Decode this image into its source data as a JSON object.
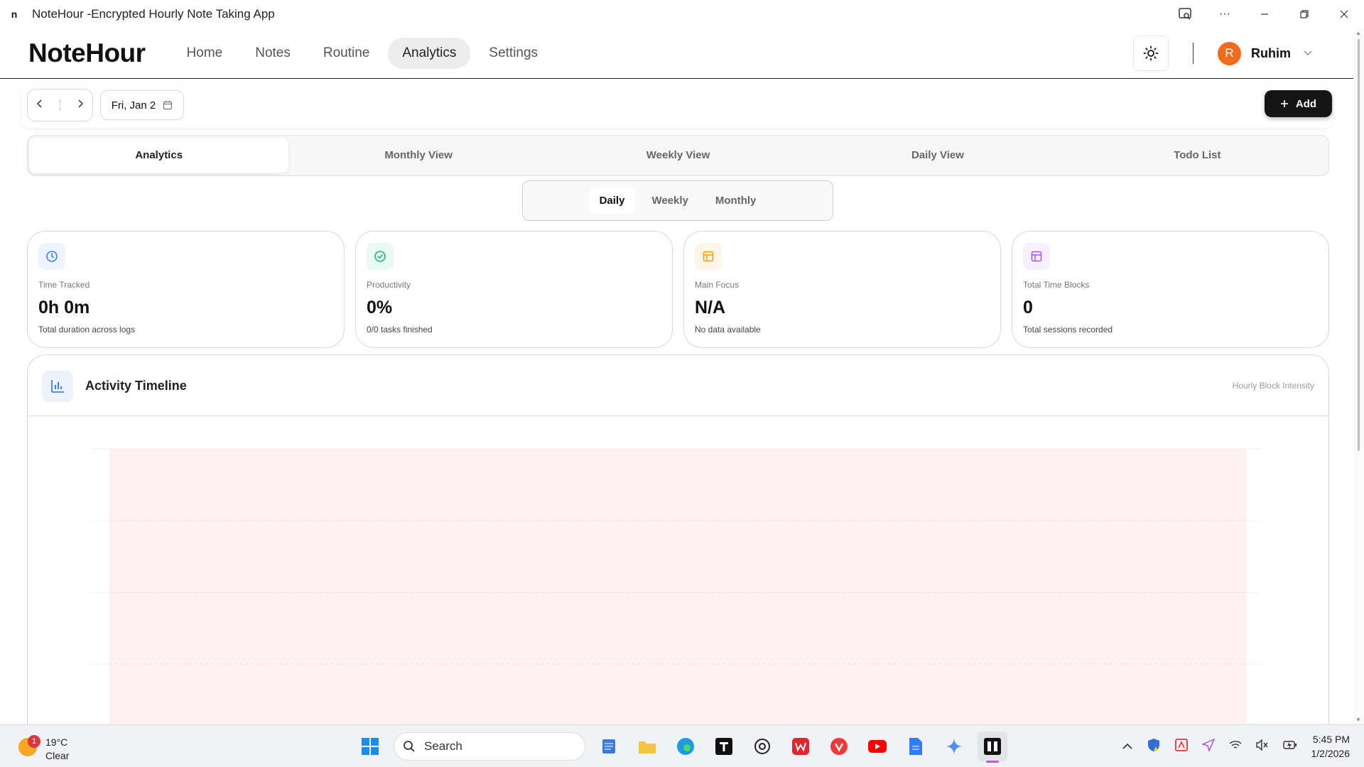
{
  "window": {
    "title": "NoteHour -Encrypted Hourly Note Taking App",
    "app_glyph": "n"
  },
  "header": {
    "brand": "NoteHour",
    "nav": [
      {
        "label": "Home"
      },
      {
        "label": "Notes"
      },
      {
        "label": "Routine"
      },
      {
        "label": "Analytics",
        "active": true
      },
      {
        "label": "Settings"
      }
    ],
    "user": {
      "initial": "R",
      "name": "Ruhim"
    }
  },
  "toolbar": {
    "date": "Fri, Jan 2",
    "add_label": "Add"
  },
  "main_tabs": [
    {
      "label": "Analytics",
      "active": true
    },
    {
      "label": "Monthly View"
    },
    {
      "label": "Weekly View"
    },
    {
      "label": "Daily View"
    },
    {
      "label": "Todo List"
    }
  ],
  "period": [
    {
      "label": "Daily",
      "active": true
    },
    {
      "label": "Weekly"
    },
    {
      "label": "Monthly"
    }
  ],
  "cards": [
    {
      "label": "Time Tracked",
      "value": "0h 0m",
      "sub": "Total duration across logs",
      "icon": "clock-icon",
      "color": "#3b82f6",
      "bg": "#eef4ff"
    },
    {
      "label": "Productivity",
      "value": "0%",
      "sub": "0/0 tasks finished",
      "icon": "check-circle-icon",
      "color": "#10b981",
      "bg": "#e9f8f2"
    },
    {
      "label": "Main Focus",
      "value": "N/A",
      "sub": "No data available",
      "icon": "layout-icon",
      "color": "#f59e0b",
      "bg": "#fff5e6"
    },
    {
      "label": "Total Time Blocks",
      "value": "0",
      "sub": "Total sessions recorded",
      "icon": "panel-icon",
      "color": "#a855f7",
      "bg": "#f6efff"
    }
  ],
  "timeline": {
    "title": "Activity Timeline",
    "right_label": "Hourly Block Intensity"
  },
  "taskbar": {
    "weather": {
      "temp": "19°C",
      "condition": "Clear",
      "badge": "1"
    },
    "search_label": "Search",
    "time": "5:45 PM",
    "date": "1/2/2026"
  },
  "colors": {
    "accent_dark": "#151515",
    "avatar": "#f26b1d",
    "chart_fill": "#fff1f1"
  }
}
